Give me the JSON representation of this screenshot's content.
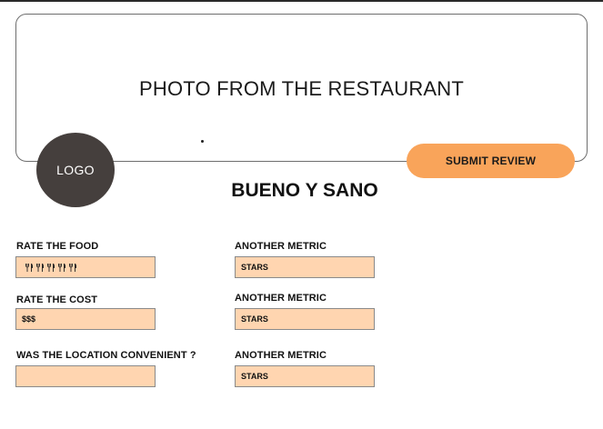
{
  "photo": {
    "label": "PHOTO FROM THE RESTAURANT"
  },
  "logo": {
    "label": "LOGO"
  },
  "submit": {
    "label": "SUBMIT REVIEW"
  },
  "restaurant": {
    "name": "BUENO Y SANO"
  },
  "form": {
    "left": [
      {
        "label": "RATE THE FOOD",
        "value": "",
        "icon_count": 5,
        "icon": "fork-knife-icon"
      },
      {
        "label": "RATE THE COST",
        "value": "$$$"
      },
      {
        "label": "WAS THE LOCATION CONVENIENT ?",
        "value": ""
      }
    ],
    "right": [
      {
        "label": "ANOTHER METRIC",
        "value": "STARS"
      },
      {
        "label": "ANOTHER METRIC",
        "value": "STARS"
      },
      {
        "label": "ANOTHER METRIC",
        "value": "STARS"
      }
    ]
  },
  "colors": {
    "accent": "#f9a45a",
    "field_fill": "#ffd5b0",
    "logo_fill": "#453f3d"
  }
}
